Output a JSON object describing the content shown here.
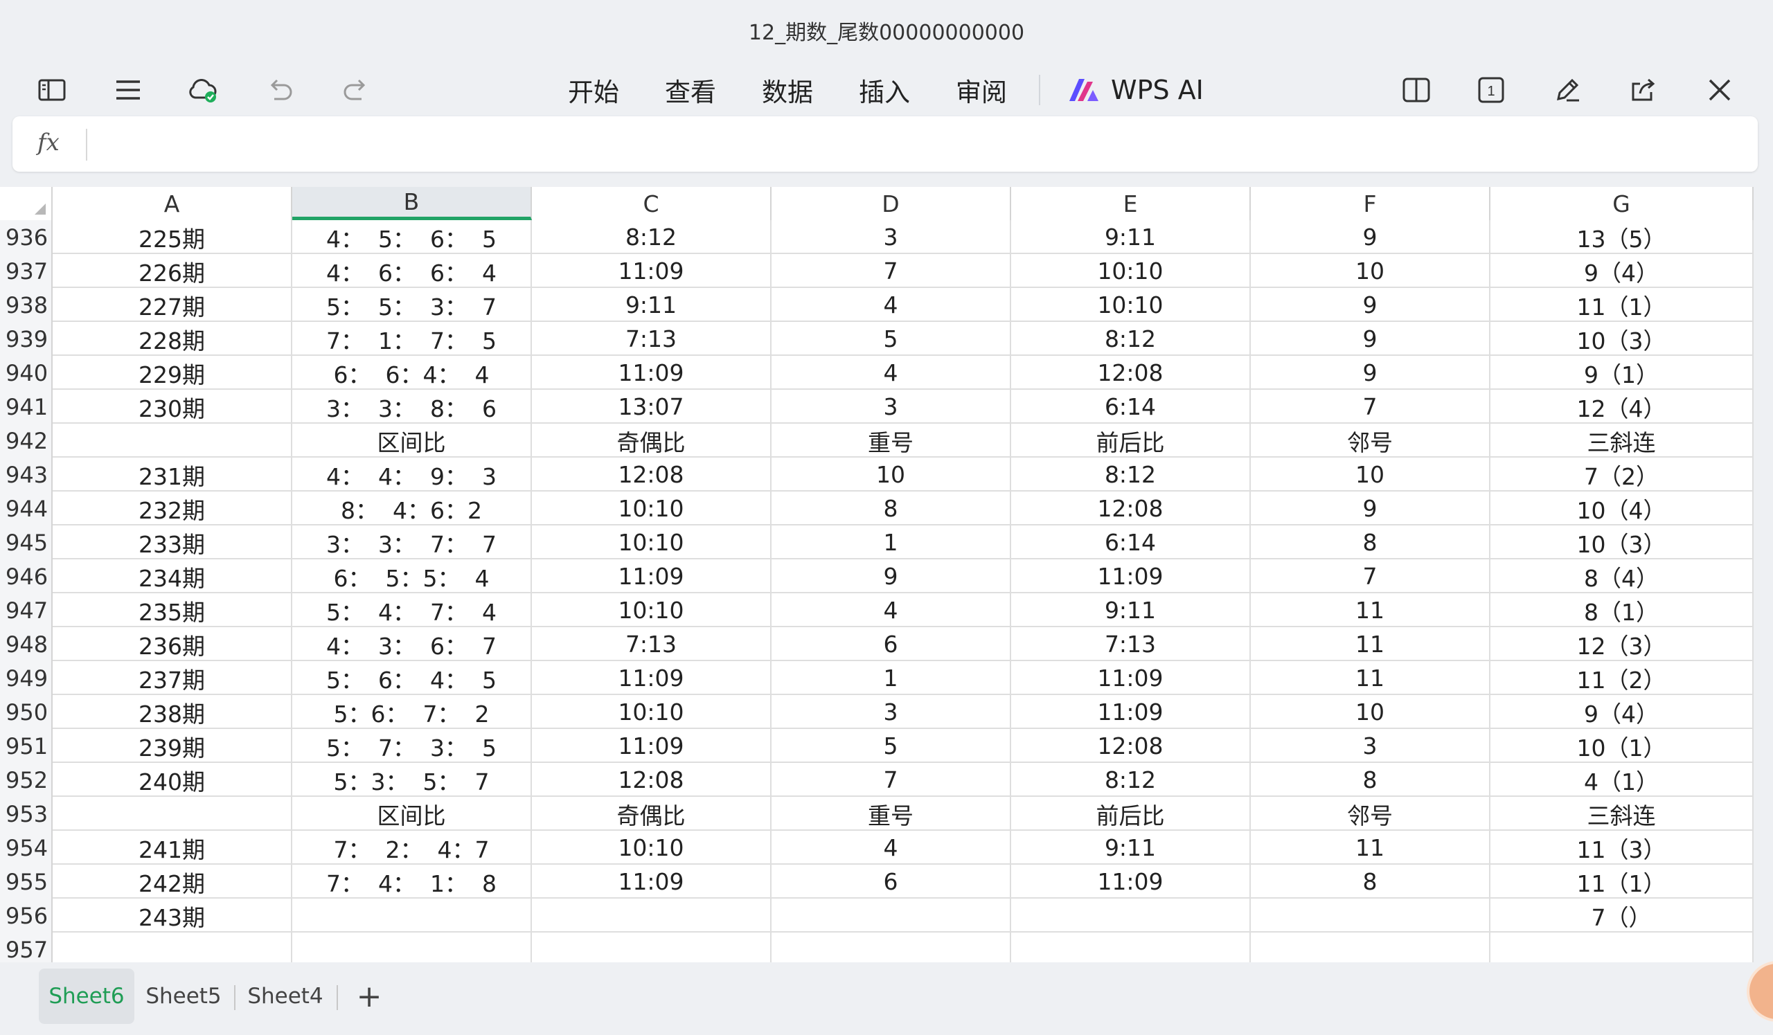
{
  "window": {
    "title": "12_期数_尾数00000000000"
  },
  "toolbar": {
    "menu": [
      "开始",
      "查看",
      "数据",
      "插入",
      "审阅"
    ],
    "ai_label": "WPS AI",
    "page_badge": "1"
  },
  "formula_bar": {
    "fx_label": "fx",
    "value": ""
  },
  "columns": [
    "A",
    "B",
    "C",
    "D",
    "E",
    "F",
    "G"
  ],
  "selected_column": "B",
  "rows": [
    {
      "n": "936",
      "cells": [
        "225期",
        "4：  5：  6：  5",
        "8:12",
        "3",
        "9:11",
        "9",
        "13（5）"
      ]
    },
    {
      "n": "937",
      "cells": [
        "226期",
        "4：  6：  6：  4",
        "11:09",
        "7",
        "10:10",
        "10",
        "9（4）"
      ]
    },
    {
      "n": "938",
      "cells": [
        "227期",
        "5：  5：  3：  7",
        "9:11",
        "4",
        "10:10",
        "9",
        "11（1）"
      ]
    },
    {
      "n": "939",
      "cells": [
        "228期",
        "7：  1：  7：  5",
        "7:13",
        "5",
        "8:12",
        "9",
        "10（3）"
      ]
    },
    {
      "n": "940",
      "cells": [
        "229期",
        "6：  6：4：  4",
        "11:09",
        "4",
        "12:08",
        "9",
        "9（1）"
      ]
    },
    {
      "n": "941",
      "cells": [
        "230期",
        "3：  3：  8：  6",
        "13:07",
        "3",
        "6:14",
        "7",
        "12（4）"
      ]
    },
    {
      "n": "942",
      "cells": [
        "",
        "区间比",
        "奇偶比",
        "重号",
        "前后比",
        "邻号",
        "三斜连"
      ]
    },
    {
      "n": "943",
      "cells": [
        "231期",
        "4：  4：  9：  3",
        "12:08",
        "10",
        "8:12",
        "10",
        "7（2）"
      ]
    },
    {
      "n": "944",
      "cells": [
        "232期",
        "8：  4：6：2",
        "10:10",
        "8",
        "12:08",
        "9",
        "10（4）"
      ]
    },
    {
      "n": "945",
      "cells": [
        "233期",
        "3：  3：  7：  7",
        "10:10",
        "1",
        "6:14",
        "8",
        "10（3）"
      ]
    },
    {
      "n": "946",
      "cells": [
        "234期",
        "6：  5：5：  4",
        "11:09",
        "9",
        "11:09",
        "7",
        "8（4）"
      ]
    },
    {
      "n": "947",
      "cells": [
        "235期",
        "5：  4：  7：  4",
        "10:10",
        "4",
        "9:11",
        "11",
        "8（1）"
      ]
    },
    {
      "n": "948",
      "cells": [
        "236期",
        "4：  3：  6：  7",
        "7:13",
        "6",
        "7:13",
        "11",
        "12（3）"
      ]
    },
    {
      "n": "949",
      "cells": [
        "237期",
        "5：  6：  4：  5",
        "11:09",
        "1",
        "11:09",
        "11",
        "11（2）"
      ]
    },
    {
      "n": "950",
      "cells": [
        "238期",
        "5：6：  7：  2",
        "10:10",
        "3",
        "11:09",
        "10",
        "9（4）"
      ]
    },
    {
      "n": "951",
      "cells": [
        "239期",
        "5：  7：  3：  5",
        "11:09",
        "5",
        "12:08",
        "3",
        "10（1）"
      ]
    },
    {
      "n": "952",
      "cells": [
        "240期",
        "5：3：  5：  7",
        "12:08",
        "7",
        "8:12",
        "8",
        "4（1）"
      ]
    },
    {
      "n": "953",
      "cells": [
        "",
        "区间比",
        "奇偶比",
        "重号",
        "前后比",
        "邻号",
        "三斜连"
      ]
    },
    {
      "n": "954",
      "cells": [
        "241期",
        "7：  2：  4：7",
        "10:10",
        "4",
        "9:11",
        "11",
        "11（3）"
      ]
    },
    {
      "n": "955",
      "cells": [
        "242期",
        "7：  4：  1：  8",
        "11:09",
        "6",
        "11:09",
        "8",
        "11（1）"
      ]
    },
    {
      "n": "956",
      "cells": [
        "243期",
        "",
        "",
        "",
        "",
        "",
        "7（）"
      ]
    },
    {
      "n": "957",
      "cells": [
        "",
        "",
        "",
        "",
        "",
        "",
        ""
      ]
    }
  ],
  "sheet_tabs": [
    {
      "label": "Sheet6",
      "active": true
    },
    {
      "label": "Sheet5",
      "active": false
    },
    {
      "label": "Sheet4",
      "active": false
    }
  ],
  "add_tab_label": "+",
  "colors": {
    "accent": "#21a366",
    "active_tab_text": "#1f9d55",
    "cloud_ok": "#1fae5b"
  }
}
